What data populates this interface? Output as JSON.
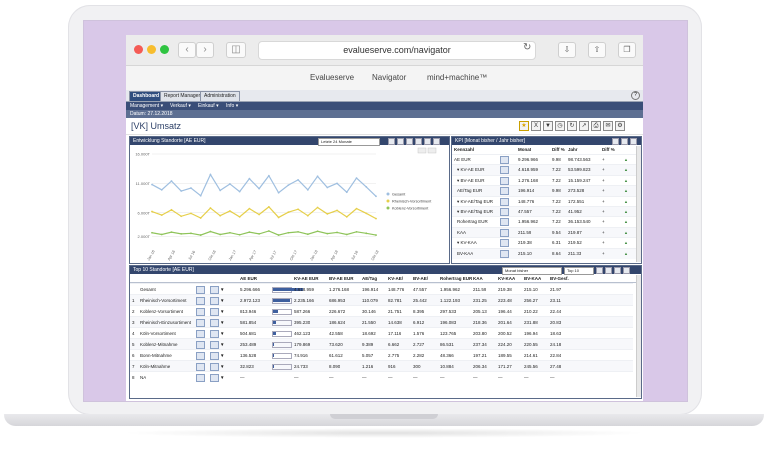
{
  "browser": {
    "url": "evalueserve.com/navigator",
    "favorites": [
      "Evalueserve",
      "Navigator",
      "mind+machine™"
    ]
  },
  "app": {
    "tabs": [
      "Dashboard",
      "Report Manager",
      "Administration"
    ],
    "menus": [
      "Management ▾",
      "Verkauf ▾",
      "Einkauf ▾",
      "Info ▾"
    ],
    "date": "Datum: 27.12.2018",
    "page_title": "[VK] Umsatz"
  },
  "chart_panel": {
    "title": "Entwicklung Standorte [AE EUR]",
    "period_select": "Letzte 24 Monate"
  },
  "chart_data": {
    "type": "line",
    "title": "",
    "ylim": [
      0,
      16000
    ],
    "yticks": [
      "16.000T",
      "11.000T",
      "6.000T",
      "2.000T"
    ],
    "xticks": [
      "Jan 16",
      "Apr 16",
      "Jul 16",
      "Okt 16",
      "Jan 17",
      "Apr 17",
      "Jul 17",
      "Okt 17",
      "Jan 18",
      "Apr 18",
      "Jul 18",
      "Okt 18"
    ],
    "series": [
      {
        "name": "Gesamt",
        "color": "#9fbfe0",
        "values": [
          10800,
          9900,
          11400,
          9700,
          10200,
          8900,
          12500,
          9800,
          10900,
          9600,
          11800,
          10100,
          12300,
          9400,
          10700,
          11600,
          9900,
          12200,
          10300,
          11000,
          9500,
          11900,
          10400,
          8800
        ]
      },
      {
        "name": "Rheinisch-Vorsortiment",
        "color": "#e6cf4a",
        "values": [
          6200,
          5600,
          6500,
          5400,
          5900,
          5100,
          6800,
          5500,
          6300,
          5300,
          6700,
          5700,
          7000,
          5200,
          6100,
          6600,
          5500,
          6900,
          5800,
          6400,
          5300,
          6700,
          5900,
          5000
        ]
      },
      {
        "name": "Koblenz-Vorsortiment",
        "color": "#8fc45a",
        "values": [
          2600,
          2300,
          2700,
          2400,
          2500,
          2200,
          2800,
          2300,
          2600,
          2250,
          2700,
          2400,
          2900,
          2200,
          2600,
          2750,
          2350,
          2850,
          2450,
          2650,
          2300,
          2750,
          2500,
          2200
        ]
      }
    ]
  },
  "kpi_panel": {
    "title": "KPI [Monat bisher / Jahr bisher]",
    "headers": [
      "Kennzahl",
      "",
      "Monat",
      "Diff %",
      "Jahr",
      "Diff %"
    ],
    "rows": [
      {
        "label": "AE EUR",
        "monat": "9.296.966",
        "d1": "9.98",
        "jahr": "98.743.563",
        "d2": "+"
      },
      {
        "label": "KV-AE EUR",
        "monat": "4.618.959",
        "d1": "7.22",
        "jahr": "53.599.823",
        "d2": "+"
      },
      {
        "label": "BV-AE EUR",
        "monat": "1.276.168",
        "d1": "7.22",
        "jahr": "15.159.247",
        "d2": "+"
      },
      {
        "label": "AE/Tag EUR",
        "monat": "196.914",
        "d1": "9.98",
        "jahr": "273.528",
        "d2": "+"
      },
      {
        "label": "KV-AE/Tag EUR",
        "monat": "148.776",
        "d1": "7.22",
        "jahr": "172.551",
        "d2": "+"
      },
      {
        "label": "BV-AE/Tag EUR",
        "monat": "47.557",
        "d1": "7.22",
        "jahr": "41.952",
        "d2": "+"
      },
      {
        "label": "Rohertrag EUR",
        "monat": "1.956.962",
        "d1": "7.22",
        "jahr": "36.153.540",
        "d2": "+"
      },
      {
        "label": "KAA",
        "monat": "211.59",
        "d1": "9.54",
        "jahr": "219.87",
        "d2": "+"
      },
      {
        "label": "KV-KAA",
        "monat": "219.38",
        "d1": "6.31",
        "jahr": "219.52",
        "d2": "+"
      },
      {
        "label": "BV-KAA",
        "monat": "215.10",
        "d1": "8.64",
        "jahr": "211.33",
        "d2": "+"
      }
    ]
  },
  "table_panel": {
    "title": "Top 10 Standorte [AE EUR]",
    "select1": "Monat bisher",
    "select2": "Top 10",
    "headers": [
      "",
      "",
      "",
      "",
      "AE EUR",
      "",
      "KV-AE EUR",
      "BV-AE EUR",
      "AE/Tag",
      "KV-AE/",
      "BV-AE/",
      "Rohertrag EUR",
      "KAA",
      "KV-KAA",
      "BV-KAA",
      "BV-Gesf."
    ],
    "rows": [
      {
        "rank": "",
        "name": "Gesamt",
        "ae": "5.296.666",
        "kv": "4.618.959",
        "bv": "1.276.168",
        "tag": "196.914",
        "kvt": "148.776",
        "bvt": "47.557",
        "roh": "1.956.962",
        "kaa": "211.59",
        "kvkaa": "219.38",
        "bvkaa": "215.10",
        "ges": "21.97"
      },
      {
        "rank": "1",
        "name": "Rheinisch-Vorsortiment",
        "ae": "2.972.123",
        "kv": "2.235.166",
        "bv": "686.953",
        "tag": "110.079",
        "kvt": "82.781",
        "bvt": "25.442",
        "roh": "1.122.193",
        "kaa": "231.25",
        "kvkaa": "223.48",
        "bvkaa": "256.27",
        "ges": "23.11"
      },
      {
        "rank": "2",
        "name": "Koblenz-Vorsortiment",
        "ae": "813.946",
        "kv": "587.266",
        "bv": "226.672",
        "tag": "30.146",
        "kvt": "21.751",
        "bvt": "8.395",
        "roh": "297.533",
        "kaa": "205.13",
        "kvkaa": "196.44",
        "bvkaa": "210.22",
        "ges": "22.44"
      },
      {
        "rank": "3",
        "name": "Rheinisch-Einzusortiment",
        "ae": "581.854",
        "kv": "395.230",
        "bv": "186.624",
        "tag": "21.550",
        "kvt": "14.638",
        "bvt": "6.912",
        "roh": "196.083",
        "kaa": "218.36",
        "kvkaa": "201.64",
        "bvkaa": "231.88",
        "ges": "20.83"
      },
      {
        "rank": "4",
        "name": "Köln-Vorsortiment",
        "ae": "504.681",
        "kv": "462.123",
        "bv": "42.558",
        "tag": "18.692",
        "kvt": "17.116",
        "bvt": "1.576",
        "roh": "123.765",
        "kaa": "203.80",
        "kvkaa": "200.52",
        "bvkaa": "196.94",
        "ges": "18.63"
      },
      {
        "rank": "5",
        "name": "Koblenz-Mitnahme",
        "ae": "253.489",
        "kv": "179.869",
        "bv": "73.620",
        "tag": "9.389",
        "kvt": "6.662",
        "bvt": "2.727",
        "roh": "86.531",
        "kaa": "237.34",
        "kvkaa": "224.20",
        "bvkaa": "220.55",
        "ges": "24.18"
      },
      {
        "rank": "6",
        "name": "Bonn-Mitnahme",
        "ae": "136.528",
        "kv": "74.916",
        "bv": "61.612",
        "tag": "5.057",
        "kvt": "2.775",
        "bvt": "2.282",
        "roh": "48.366",
        "kaa": "197.21",
        "kvkaa": "189.55",
        "bvkaa": "214.61",
        "ges": "22.84"
      },
      {
        "rank": "7",
        "name": "Köln-Mitnahme",
        "ae": "32.823",
        "kv": "24.733",
        "bv": "8.090",
        "tag": "1.216",
        "kvt": "916",
        "bvt": "300",
        "roh": "10.884",
        "kaa": "206.34",
        "kvkaa": "171.27",
        "bvkaa": "245.56",
        "ges": "27.48"
      },
      {
        "rank": "8",
        "name": "NA",
        "ae": "—",
        "kv": "—",
        "bv": "—",
        "tag": "—",
        "kvt": "—",
        "bvt": "—",
        "roh": "—",
        "kaa": "—",
        "kvkaa": "—",
        "bvkaa": "—",
        "ges": "—"
      }
    ]
  }
}
